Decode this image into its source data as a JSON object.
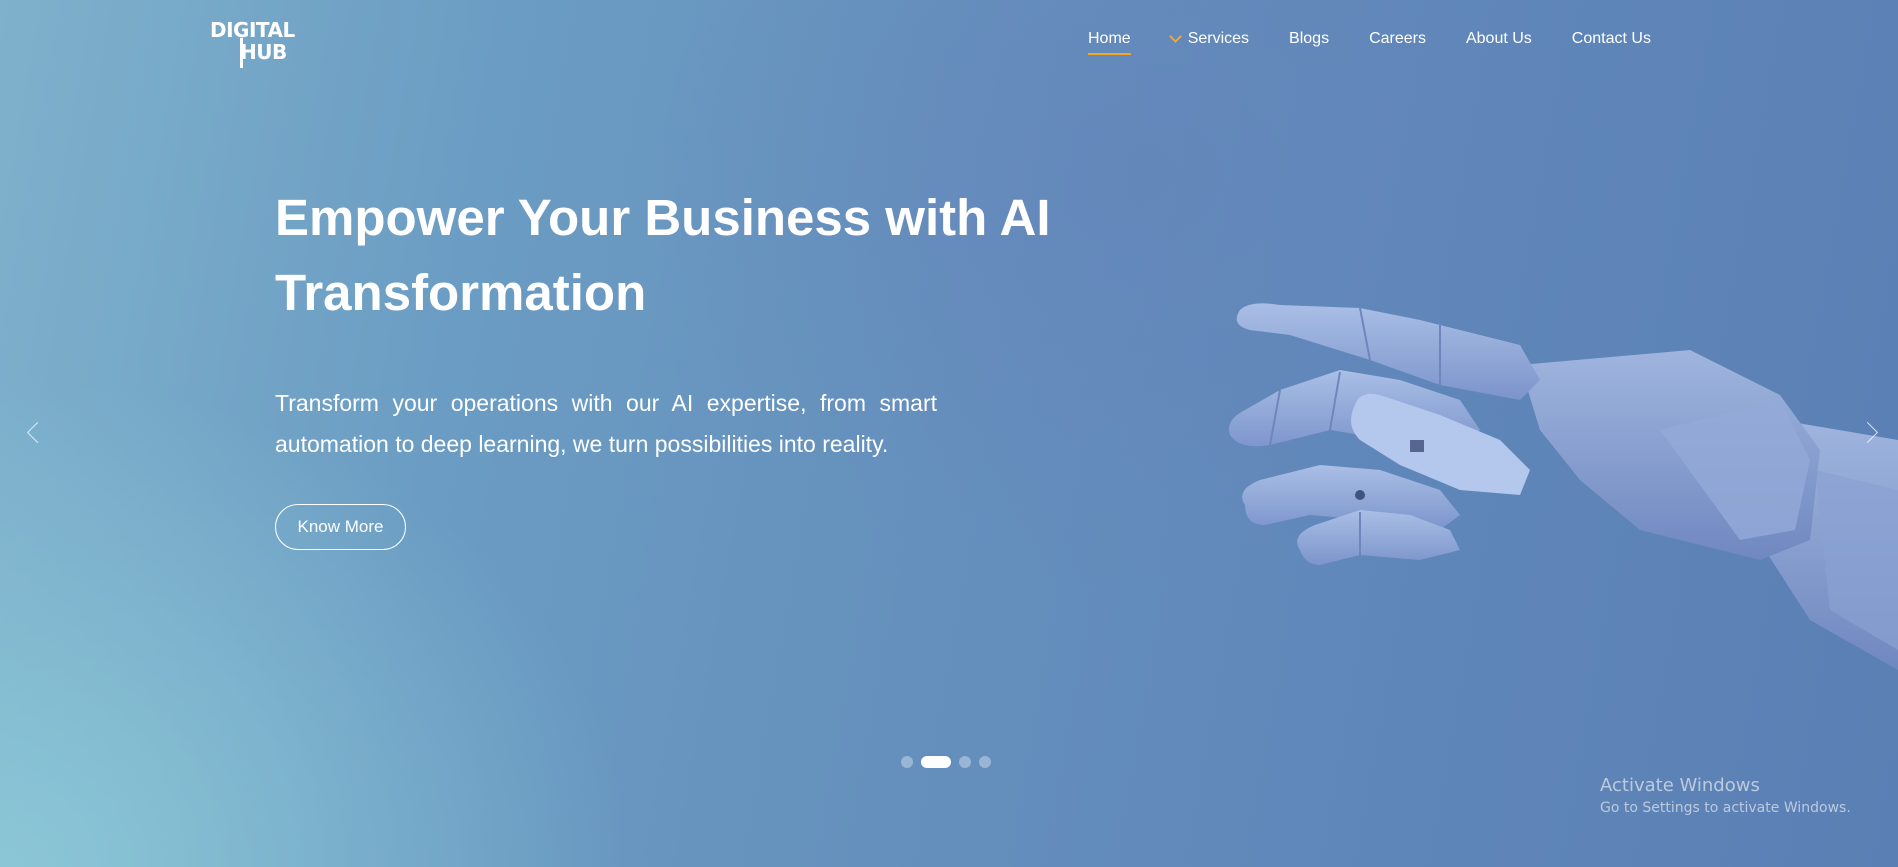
{
  "logo": {
    "line1": "DIGITAL",
    "line2": "HUB"
  },
  "nav": [
    {
      "label": "Home",
      "active": true
    },
    {
      "label": "Services",
      "has_dropdown": true
    },
    {
      "label": "Blogs"
    },
    {
      "label": "Careers"
    },
    {
      "label": "About Us"
    },
    {
      "label": "Contact Us"
    }
  ],
  "hero": {
    "headline": "Empower Your Business with AI Transformation",
    "subtext": "Transform your operations with our AI expertise, from smart automation to deep learning, we turn possibilities into reality.",
    "cta_label": "Know More"
  },
  "carousel": {
    "slide_count": 4,
    "active_index": 1
  },
  "watermark": {
    "line1": "Activate Windows",
    "line2": "Go to Settings to activate Windows."
  },
  "colors": {
    "accent": "#f5a623",
    "text": "#ffffff",
    "bg_start": "#7fb1cc",
    "bg_end": "#5a7fb4"
  },
  "icons": {
    "prev": "chevron-left-icon",
    "next": "chevron-right-icon",
    "dropdown": "chevron-down-icon"
  }
}
